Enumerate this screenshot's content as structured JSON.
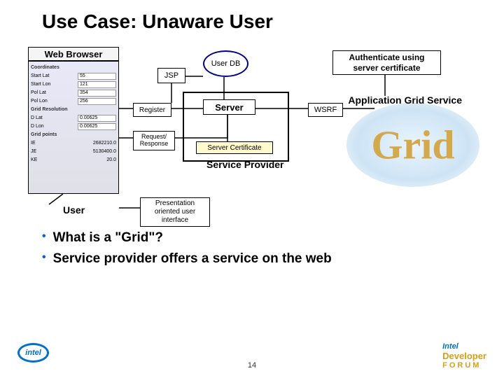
{
  "title": "Use Case: Unaware User",
  "diagram": {
    "web_browser": "Web Browser",
    "jsp": "JSP",
    "user_db": "User DB",
    "register": "Register",
    "request_response": "Request/ Response",
    "server": "Server",
    "server_certificate": "Server Certificate",
    "service_provider": "Service Provider",
    "user": "User",
    "presentation": "Presentation oriented user interface",
    "authenticate": "Authenticate using server certificate",
    "wsrf": "WSRF",
    "application": "Application Grid Service",
    "grid_word": "Grid"
  },
  "browser_form": {
    "section1": "Coordinates",
    "rows": [
      {
        "label": "Start Lat",
        "value": "55"
      },
      {
        "label": "Start Lon",
        "value": "121"
      },
      {
        "label": "Pol Lat",
        "value": "354"
      },
      {
        "label": "Pol Lon",
        "value": "256"
      }
    ],
    "section2": "Grid Resolution",
    "rows2": [
      {
        "label": "D Lat",
        "value": "0.00625"
      },
      {
        "label": "D Lon",
        "value": "0.00625"
      }
    ],
    "section3": "Grid points",
    "rows3": [
      {
        "label": "IE",
        "value": "2682210.0"
      },
      {
        "label": "JE",
        "value": "5130400.0"
      },
      {
        "label": "KE",
        "value": "20.0"
      }
    ]
  },
  "bullets": [
    "What is a \"Grid\"?",
    "Service provider offers a service on the web"
  ],
  "page_number": "14",
  "logos": {
    "intel": "intel",
    "idf_brand": "Intel",
    "idf_line1": "Developer",
    "idf_line2": "FORUM"
  }
}
